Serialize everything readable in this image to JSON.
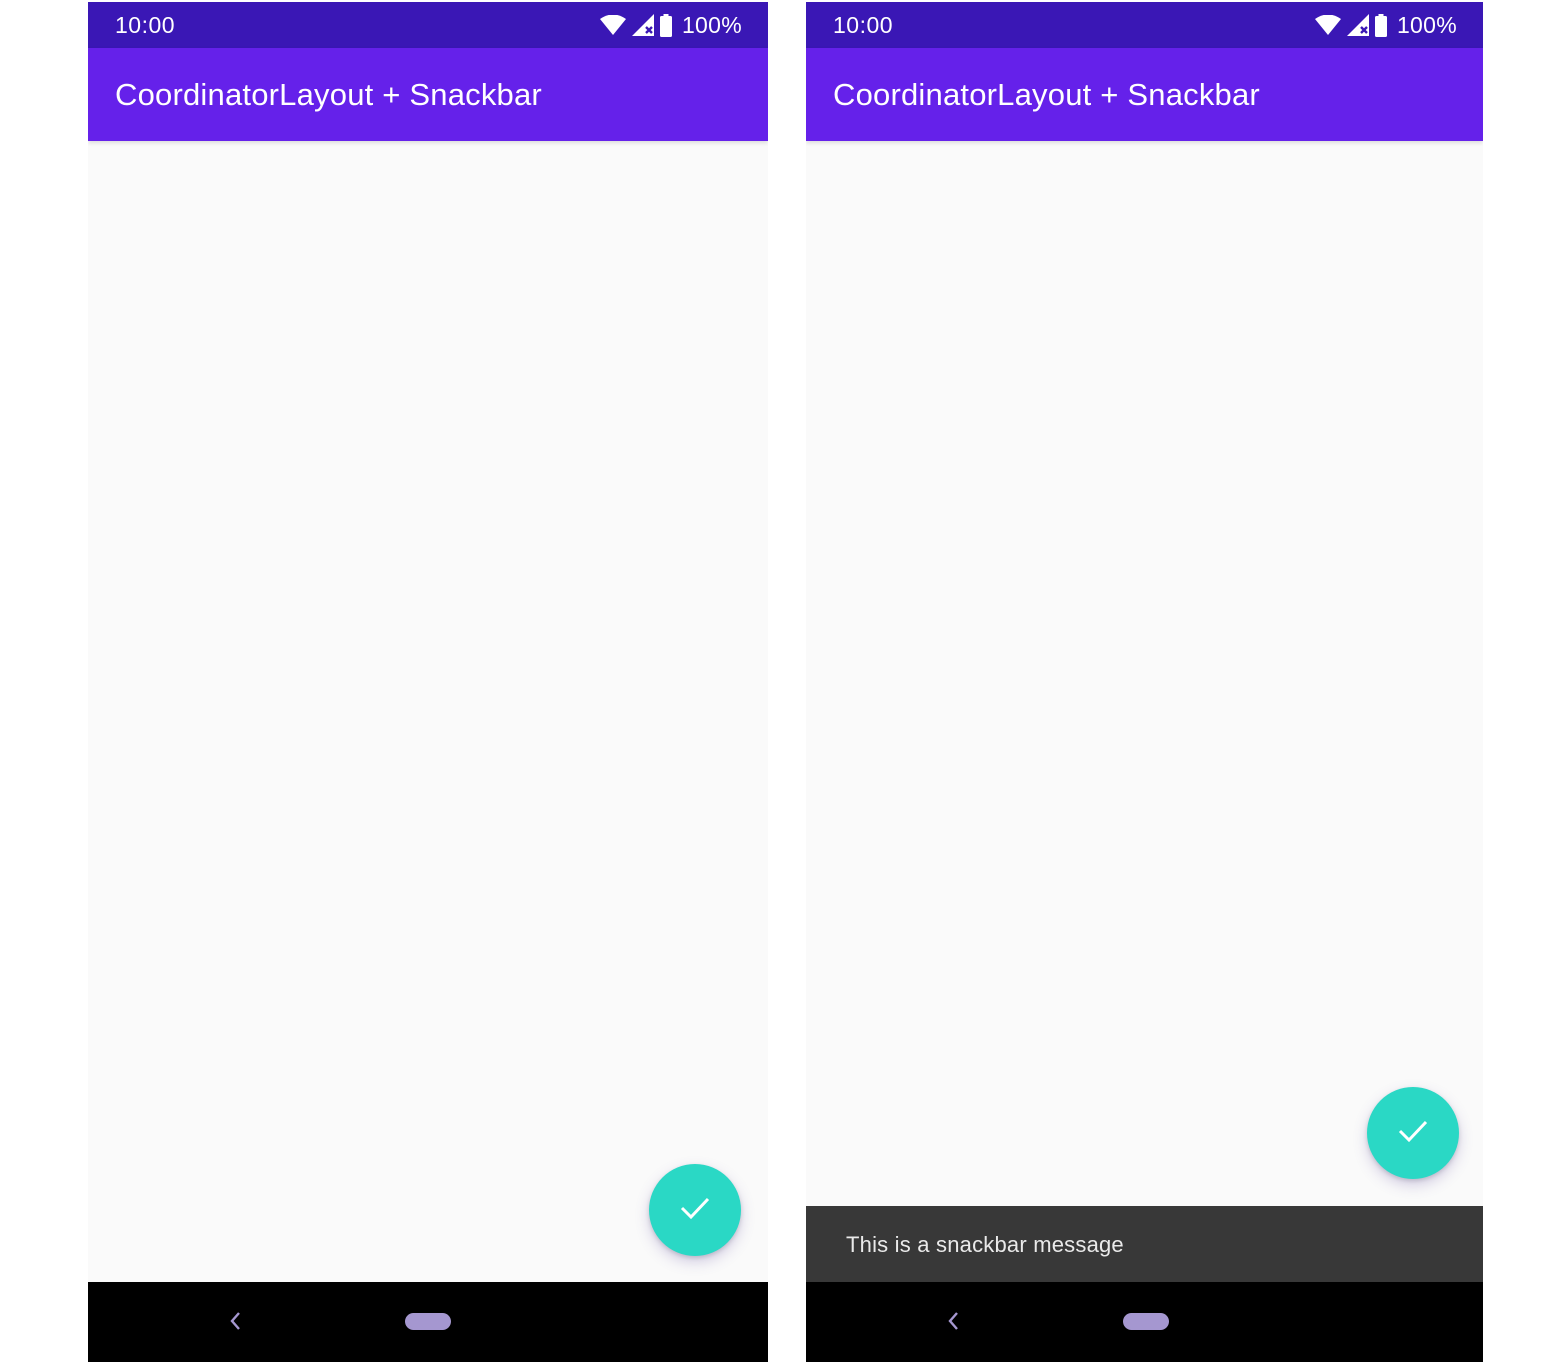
{
  "colors": {
    "status_bar": "#3a17b5",
    "app_bar": "#6521ea",
    "fab": "#2ad8c5",
    "snackbar": "#383838",
    "nav_bar": "#000000",
    "home_pill": "#a597d0"
  },
  "screens": [
    {
      "status_bar": {
        "time": "10:00",
        "battery": "100%",
        "icons": [
          "wifi-icon",
          "signal-icon",
          "battery-icon"
        ]
      },
      "app_bar": {
        "title": "CoordinatorLayout + Snackbar"
      },
      "fab": {
        "icon": "check-icon"
      },
      "nav_bar": {
        "icons": [
          "back-icon",
          "home-pill"
        ]
      }
    },
    {
      "status_bar": {
        "time": "10:00",
        "battery": "100%",
        "icons": [
          "wifi-icon",
          "signal-icon",
          "battery-icon"
        ]
      },
      "app_bar": {
        "title": "CoordinatorLayout + Snackbar"
      },
      "fab": {
        "icon": "check-icon"
      },
      "snackbar": {
        "message": "This is a snackbar message"
      },
      "nav_bar": {
        "icons": [
          "back-icon",
          "home-pill"
        ]
      }
    }
  ]
}
